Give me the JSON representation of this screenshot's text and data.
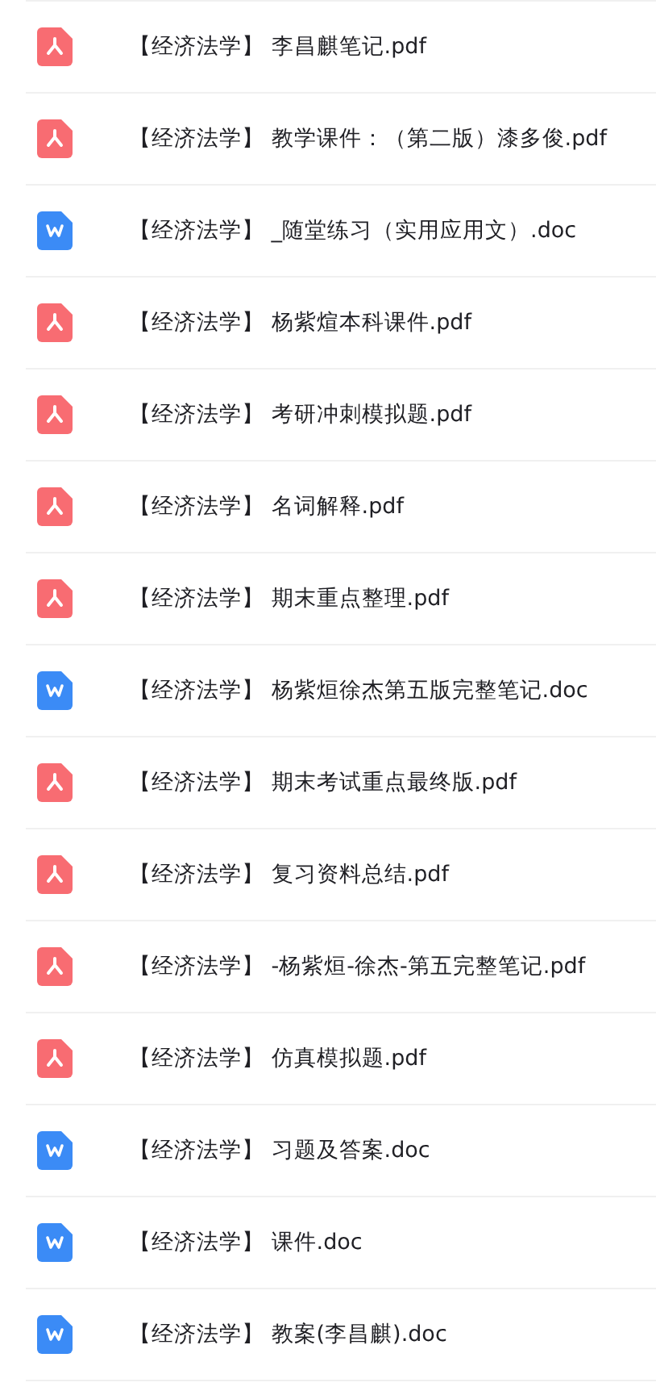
{
  "files": [
    {
      "kind": "pdf",
      "name": "【经济法学】 李昌麒笔记.pdf"
    },
    {
      "kind": "pdf",
      "name": "【经济法学】 教学课件：（第二版）漆多俊.pdf"
    },
    {
      "kind": "doc",
      "name": "【经济法学】 _随堂练习（实用应用文）.doc"
    },
    {
      "kind": "pdf",
      "name": "【经济法学】 杨紫煊本科课件.pdf"
    },
    {
      "kind": "pdf",
      "name": "【经济法学】 考研冲刺模拟题.pdf"
    },
    {
      "kind": "pdf",
      "name": "【经济法学】 名词解释.pdf"
    },
    {
      "kind": "pdf",
      "name": "【经济法学】 期末重点整理.pdf"
    },
    {
      "kind": "doc",
      "name": "【经济法学】 杨紫烜徐杰第五版完整笔记.doc"
    },
    {
      "kind": "pdf",
      "name": "【经济法学】 期末考试重点最终版.pdf"
    },
    {
      "kind": "pdf",
      "name": "【经济法学】 复习资料总结.pdf"
    },
    {
      "kind": "pdf",
      "name": "【经济法学】 -杨紫烜-徐杰-第五完整笔记.pdf"
    },
    {
      "kind": "pdf",
      "name": "【经济法学】 仿真模拟题.pdf"
    },
    {
      "kind": "doc",
      "name": "【经济法学】 习题及答案.doc"
    },
    {
      "kind": "doc",
      "name": "【经济法学】 课件.doc"
    },
    {
      "kind": "doc",
      "name": "【经济法学】 教案(李昌麒).doc"
    }
  ]
}
